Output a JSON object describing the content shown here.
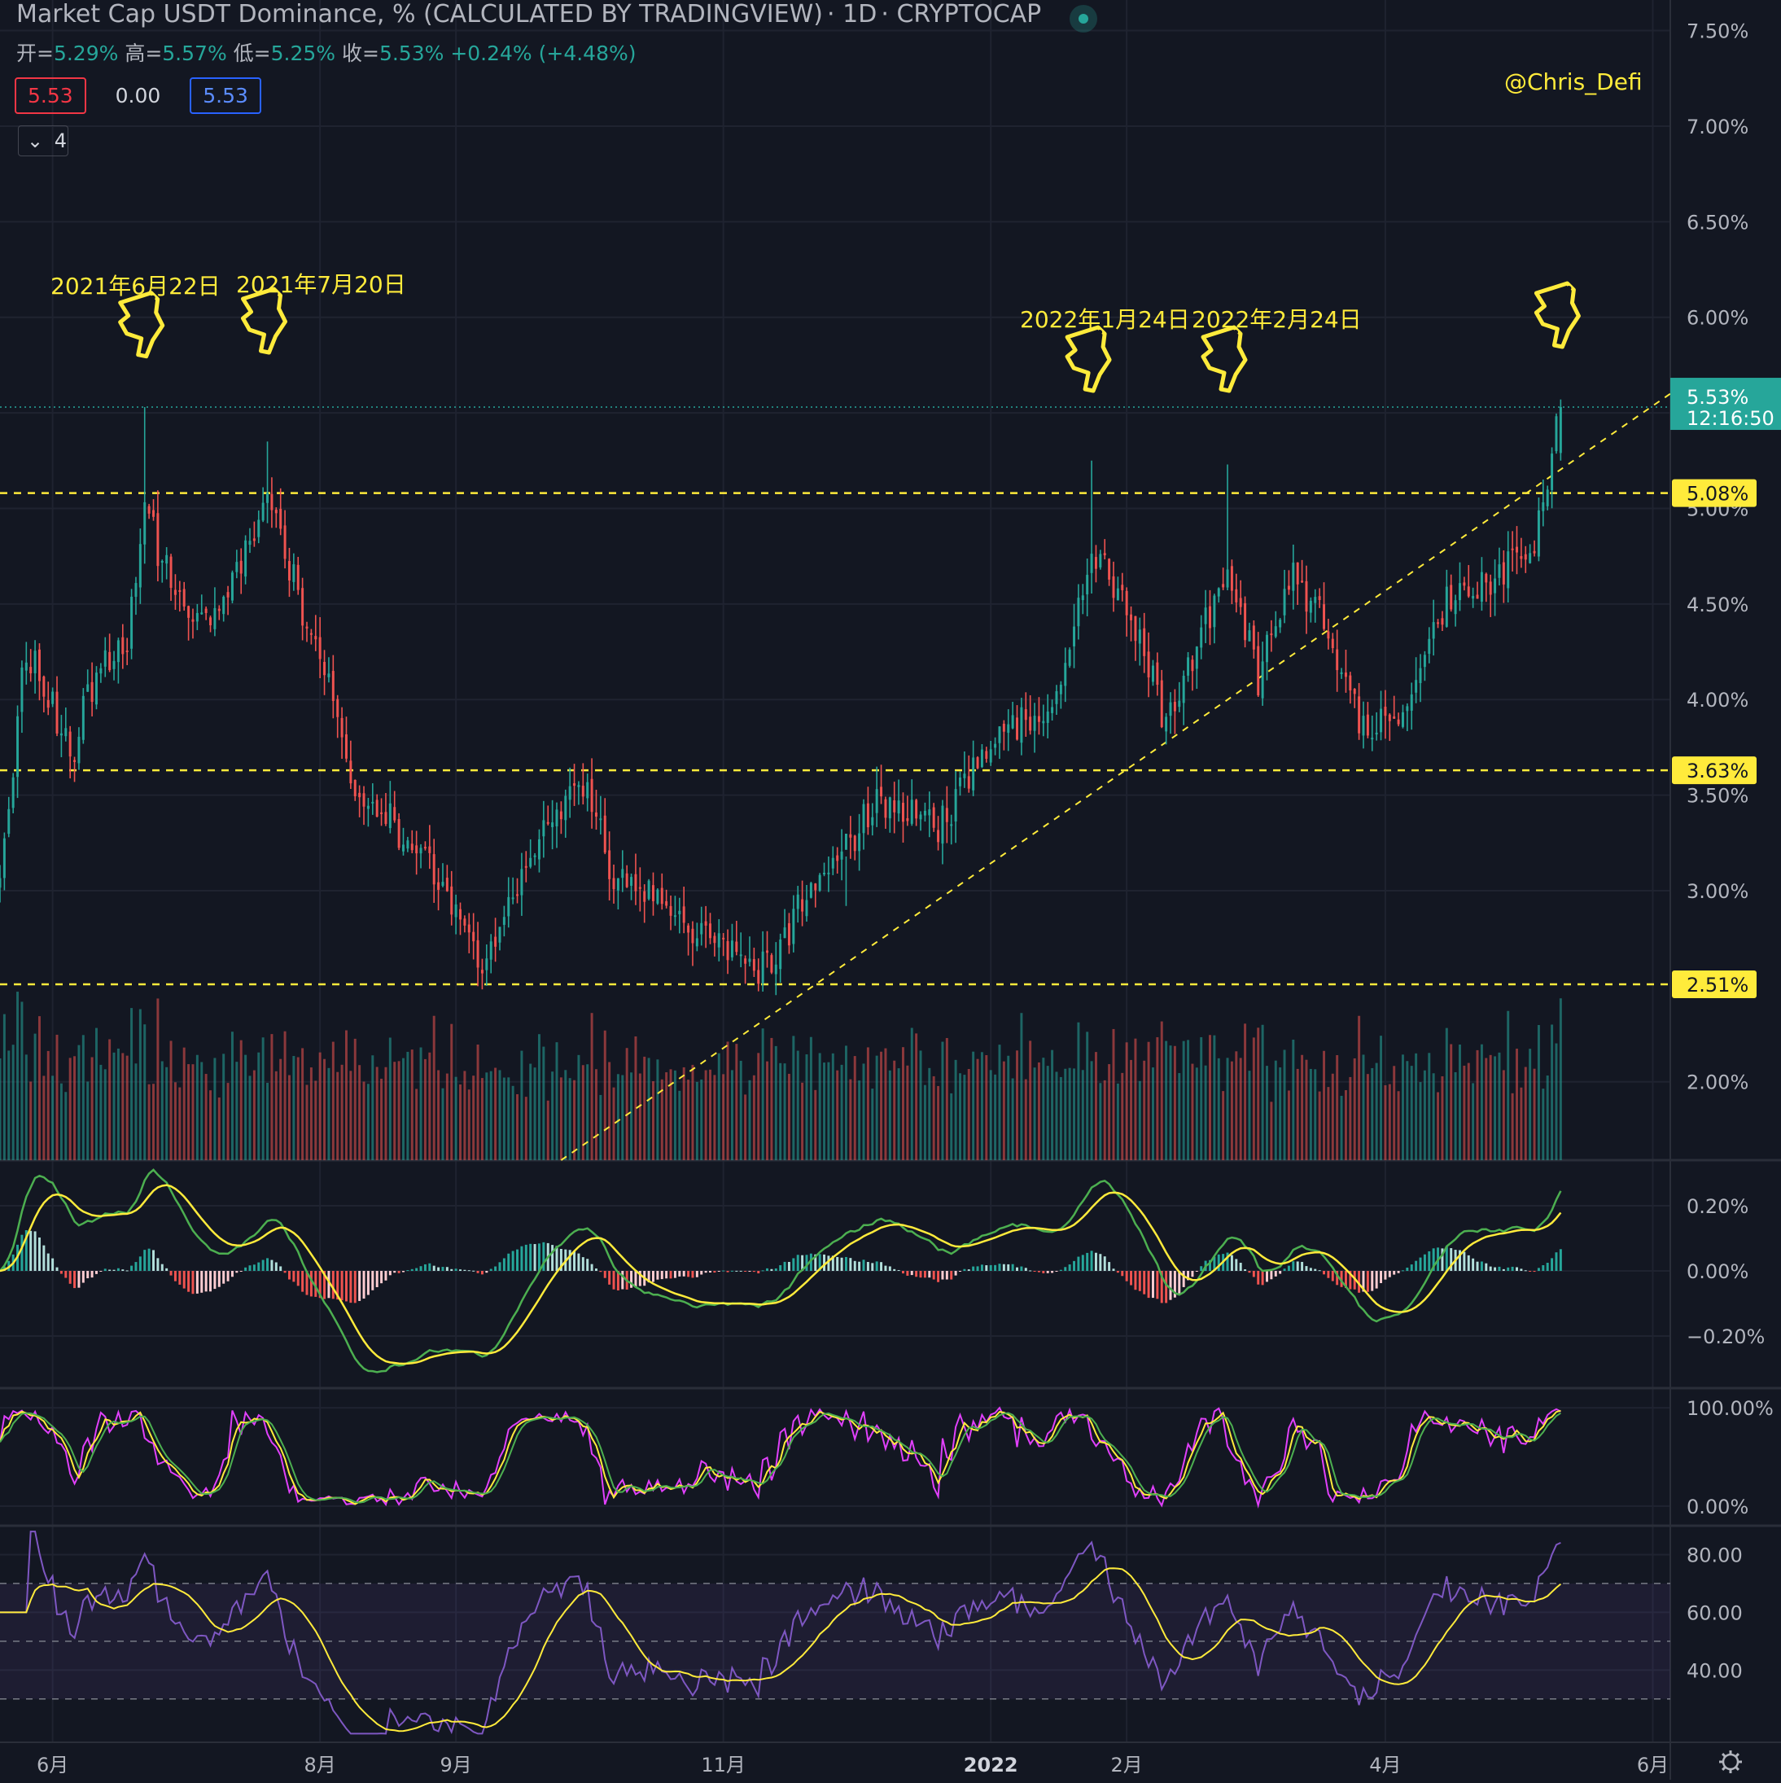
{
  "header": {
    "title": "Market Cap USDT Dominance, % (CALCULATED BY TRADINGVIEW)",
    "interval": "1D",
    "source": "CRYPTOCAP",
    "open_label": "开=",
    "open_value": "5.29%",
    "high_label": "高=",
    "high_value": "5.57%",
    "low_label": "低=",
    "low_value": "5.25%",
    "close_label": "收=",
    "close_value": "5.53%",
    "change_value": "+0.24% (+4.48%)",
    "box_left": "5.53",
    "box_mid": "0.00",
    "box_right": "5.53",
    "indicators_toggle": "4",
    "watermark": "@Chris_Defi"
  },
  "annotations": [
    {
      "text": "2021年6月22日"
    },
    {
      "text": "2021年7月20日"
    },
    {
      "text": "2022年1月24日"
    },
    {
      "text": "2022年2月24日"
    }
  ],
  "chart_data": {
    "type": "candlestick",
    "title": "Market Cap USDT Dominance, % (CALCULATED BY TRADINGVIEW)",
    "x_start": "2021-05-20",
    "x_end": "2022-06-05",
    "last_bar_date": "2022-05-11",
    "xticks": [
      {
        "date": "2021-06-01",
        "label": "6月",
        "bold": false
      },
      {
        "date": "2021-08-01",
        "label": "8月",
        "bold": false
      },
      {
        "date": "2021-09-01",
        "label": "9月",
        "bold": false
      },
      {
        "date": "2021-11-01",
        "label": "11月",
        "bold": false
      },
      {
        "date": "2022-01-01",
        "label": "2022",
        "bold": true
      },
      {
        "date": "2022-02-01",
        "label": "2月",
        "bold": false
      },
      {
        "date": "2022-04-01",
        "label": "4月",
        "bold": false
      },
      {
        "date": "2022-06-01",
        "label": "6月",
        "bold": false
      }
    ],
    "price_panel": {
      "ylim": [
        1.59,
        7.66
      ],
      "yticks": [
        "7.50%",
        "7.00%",
        "6.50%",
        "6.00%",
        "5.50%",
        "5.00%",
        "4.50%",
        "4.00%",
        "3.50%",
        "3.00%",
        "2.00%"
      ],
      "ytick_values": [
        7.5,
        7.0,
        6.5,
        6.0,
        5.5,
        5.0,
        4.5,
        4.0,
        3.5,
        3.0,
        2.0
      ],
      "anchors": [
        {
          "date": "2021-05-20",
          "close": 3.0
        },
        {
          "date": "2021-05-26",
          "close": 4.3
        },
        {
          "date": "2021-06-05",
          "close": 3.7
        },
        {
          "date": "2021-06-12",
          "close": 4.2
        },
        {
          "date": "2021-06-18",
          "close": 4.3
        },
        {
          "date": "2021-06-22",
          "close": 5.0
        },
        {
          "date": "2021-06-30",
          "close": 4.5
        },
        {
          "date": "2021-07-08",
          "close": 4.4
        },
        {
          "date": "2021-07-20",
          "close": 5.1
        },
        {
          "date": "2021-08-01",
          "close": 4.2
        },
        {
          "date": "2021-08-10",
          "close": 3.5
        },
        {
          "date": "2021-08-25",
          "close": 3.2
        },
        {
          "date": "2021-09-07",
          "close": 2.6
        },
        {
          "date": "2021-09-20",
          "close": 3.3
        },
        {
          "date": "2021-09-29",
          "close": 3.6
        },
        {
          "date": "2021-10-07",
          "close": 3.1
        },
        {
          "date": "2021-10-20",
          "close": 2.9
        },
        {
          "date": "2021-11-10",
          "close": 2.6
        },
        {
          "date": "2021-11-25",
          "close": 3.1
        },
        {
          "date": "2021-12-06",
          "close": 3.5
        },
        {
          "date": "2021-12-20",
          "close": 3.3
        },
        {
          "date": "2022-01-04",
          "close": 3.9
        },
        {
          "date": "2022-01-15",
          "close": 3.9
        },
        {
          "date": "2022-01-24",
          "close": 4.8
        },
        {
          "date": "2022-02-01",
          "close": 4.5
        },
        {
          "date": "2022-02-10",
          "close": 3.9
        },
        {
          "date": "2022-02-24",
          "close": 4.7
        },
        {
          "date": "2022-03-03",
          "close": 4.1
        },
        {
          "date": "2022-03-11",
          "close": 4.7
        },
        {
          "date": "2022-03-20",
          "close": 4.3
        },
        {
          "date": "2022-03-28",
          "close": 3.8
        },
        {
          "date": "2022-04-05",
          "close": 3.9
        },
        {
          "date": "2022-04-15",
          "close": 4.5
        },
        {
          "date": "2022-04-25",
          "close": 4.6
        },
        {
          "date": "2022-05-05",
          "close": 4.8
        },
        {
          "date": "2022-05-11",
          "close": 5.53
        }
      ],
      "highs": [
        {
          "date": "2021-06-22",
          "value": 5.53
        },
        {
          "date": "2021-07-20",
          "value": 5.35
        },
        {
          "date": "2022-01-24",
          "value": 5.25
        },
        {
          "date": "2022-02-24",
          "value": 5.23
        },
        {
          "date": "2021-11-29",
          "value": 2.92
        }
      ],
      "horizontal_lines": [
        {
          "value": 5.08,
          "label": "5.08%"
        },
        {
          "value": 3.63,
          "label": "3.63%"
        },
        {
          "value": 2.51,
          "label": "2.51%"
        }
      ],
      "trendline": {
        "from": {
          "date": "2021-09-25",
          "value": 1.59
        },
        "to": {
          "date": "2022-06-05",
          "value": 5.6
        }
      },
      "last_price": {
        "value": 5.53,
        "label": "5.53%",
        "countdown": "12:16:50"
      },
      "pointer_markers": [
        {
          "date": "2021-06-22",
          "value": 6.0
        },
        {
          "date": "2021-07-20",
          "value": 6.02
        },
        {
          "date": "2022-01-24",
          "value": 5.82
        },
        {
          "date": "2022-02-24",
          "value": 5.82
        },
        {
          "date": "2022-05-11",
          "value": 6.05
        }
      ]
    },
    "macd_panel": {
      "ylim": [
        -0.36,
        0.34
      ],
      "yticks": [
        "0.20%",
        "0.00%",
        "−0.20%"
      ],
      "ytick_values": [
        0.2,
        0.0,
        -0.2
      ]
    },
    "stoch_panel": {
      "ylim": [
        -20,
        120
      ],
      "yticks": [
        "100.00%",
        "0.00%"
      ],
      "ytick_values": [
        100,
        0
      ]
    },
    "rsi_panel": {
      "ylim": [
        15,
        90
      ],
      "yticks": [
        "80.00",
        "60.00",
        "40.00"
      ],
      "ytick_values": [
        80,
        60,
        40
      ],
      "band": [
        30,
        70
      ],
      "midline": 50
    },
    "colors": {
      "up": "#26a69a",
      "down": "#ef5350",
      "level_line": "#ffeb3b",
      "last_price": "#26a69a",
      "macd_line": "#4caf50",
      "signal_line": "#ffeb3b",
      "stoch_k": "#e040fb",
      "stoch_d": "#4caf50",
      "rsi_line": "#7e57c2",
      "rsi_ma": "#ffeb3b"
    }
  }
}
